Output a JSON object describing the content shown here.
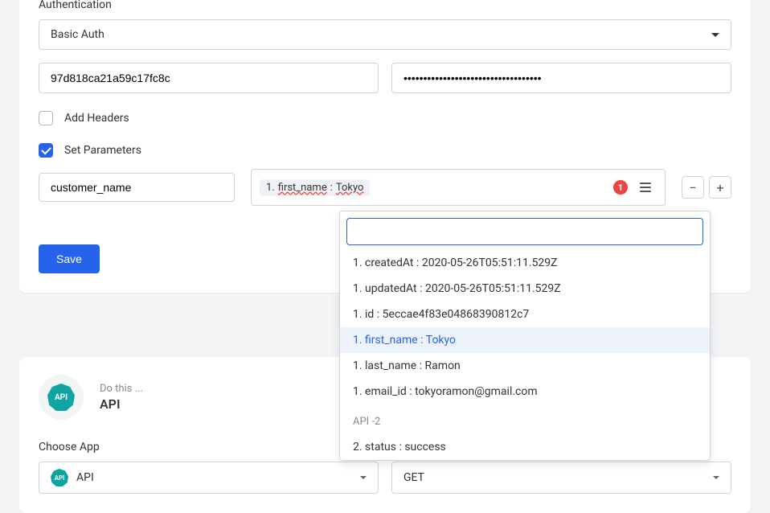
{
  "auth": {
    "label": "Authentication",
    "type": "Basic Auth",
    "username": "97d818ca21a59c17fc8c",
    "password_mask": "•••••••••••••••••••••••••••••••••••"
  },
  "headers": {
    "label": "Add Headers",
    "checked": false
  },
  "parameters": {
    "label": "Set Parameters",
    "checked": true,
    "key": "customer_name",
    "value_tag_prefix": "1.",
    "value_tag_key": "first_name",
    "value_tag_sep": ":",
    "value_tag_val": "Tokyo",
    "badge_count": "1"
  },
  "save_label": "Save",
  "dropdown": {
    "search_value": "",
    "items": [
      {
        "text": "1. createdAt : 2020-05-26T05:51:11.529Z",
        "selected": false
      },
      {
        "text": "1. updatedAt : 2020-05-26T05:51:11.529Z",
        "selected": false
      },
      {
        "text": "1. id : 5eccae4f83e04868390812c7",
        "selected": false
      },
      {
        "text": "1. first_name : Tokyo",
        "selected": true
      },
      {
        "text": "1. last_name : Ramon",
        "selected": false
      },
      {
        "text": "1. email_id : tokyoramon@gmail.com",
        "selected": false
      }
    ],
    "group2_label": "API -2",
    "group2_items": [
      {
        "text": "2. status : success",
        "selected": false
      }
    ]
  },
  "bottom": {
    "do_label": "Do this ...",
    "app_name": "API",
    "choose_label": "Choose App",
    "app_selected": "API",
    "method_selected": "GET",
    "icon_text": "API"
  }
}
